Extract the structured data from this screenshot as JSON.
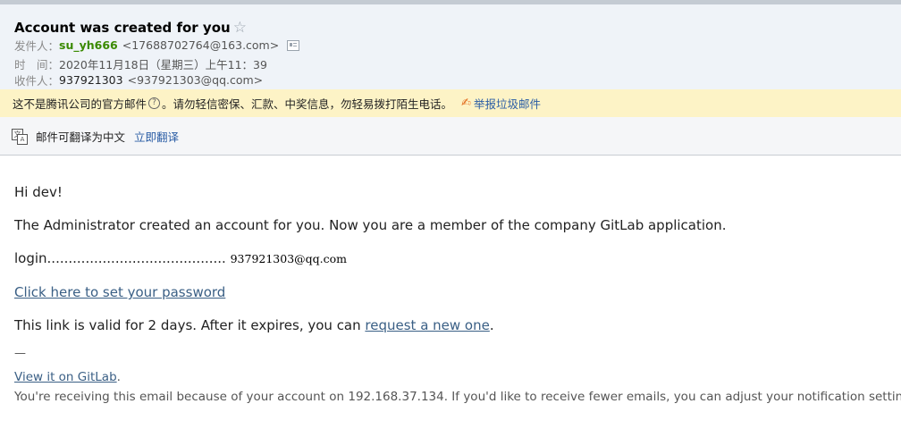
{
  "header": {
    "subject": "Account was created for you",
    "star_icon": "☆",
    "from_label": "发件人：",
    "from_name": "su_yh666",
    "from_addr": "<17688702764@163.com>",
    "time_label": "时　间：",
    "time_value": "2020年11月18日（星期三）上午11：39",
    "to_label": "收件人：",
    "to_name": "937921303",
    "to_addr": "<937921303@qq.com>"
  },
  "warning": {
    "text_before": "这不是腾讯公司的官方邮件",
    "help_icon": "?",
    "text_after": "。请勿轻信密保、汇款、中奖信息，勿轻易拨打陌生电话。",
    "report_label": "举报垃圾邮件"
  },
  "translate": {
    "text": "邮件可翻译为中文",
    "link": "立即翻译"
  },
  "body": {
    "greeting": "Hi dev!",
    "intro": "The Administrator created an account for you. Now you are a member of the company GitLab application.",
    "login_prefix": "login..........................................",
    "login_value": "937921303@qq.com",
    "set_password_link": "Click here to set your password",
    "validity_prefix": "This link is valid for 2 days. After it expires, you can ",
    "request_link": "request a new one",
    "validity_suffix": ".",
    "separator": "—",
    "view_link": "View it on GitLab",
    "view_suffix": ".",
    "footer_text": "You're receiving this email because of your account on 192.168.37.134. If you'd like to receive fewer emails, you can adjust your notification settings."
  },
  "colors": {
    "header_bg": "#eff3f8",
    "warning_bg": "#fdf3c6",
    "sender_green": "#3a8a00",
    "link_blue": "#2a5da5"
  }
}
